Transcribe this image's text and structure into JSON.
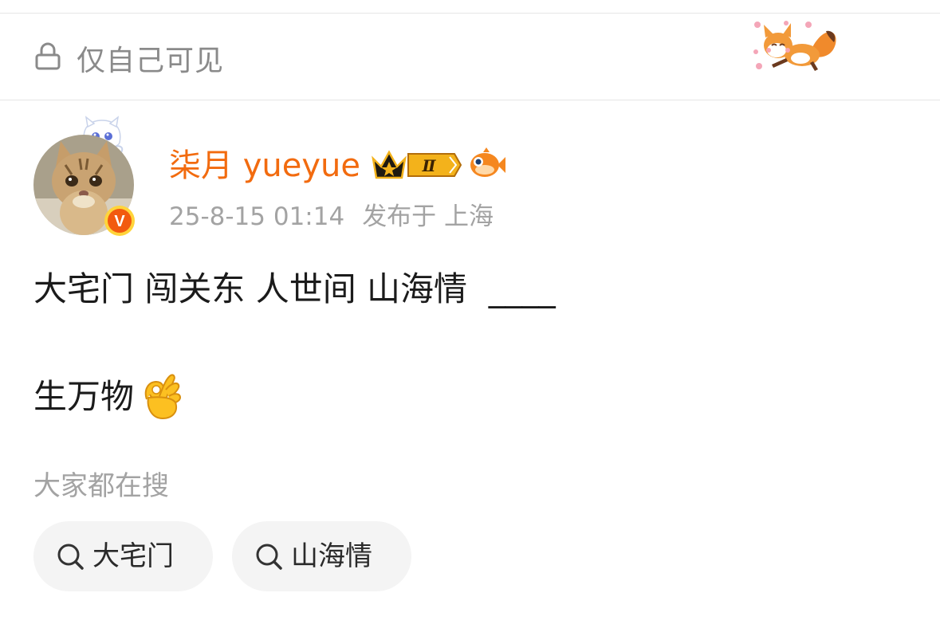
{
  "privacy": {
    "label": "仅自己可见",
    "icon": "lock-icon"
  },
  "post": {
    "author": {
      "name": "柒月 yueyue",
      "name_color": "#f26b0f",
      "avatar": "cat-avatar",
      "verified_badge": "V",
      "level_badge": "Ⅱ"
    },
    "time": "25-8-15 01:14",
    "location": "发布于 上海",
    "body": {
      "line1": "大宅门 闯关东 人世间 山海情  ____",
      "line2": "生万物",
      "emoji": "ok-hand-emoji"
    }
  },
  "search": {
    "heading": "大家都在搜",
    "chips": [
      {
        "label": "大宅门",
        "icon": "search-icon"
      },
      {
        "label": "山海情",
        "icon": "search-icon"
      }
    ]
  },
  "colors": {
    "accent": "#f26b0f",
    "muted_text": "#a3a3a3",
    "chip_bg": "#f4f4f4",
    "divider": "#e6e6e6"
  }
}
